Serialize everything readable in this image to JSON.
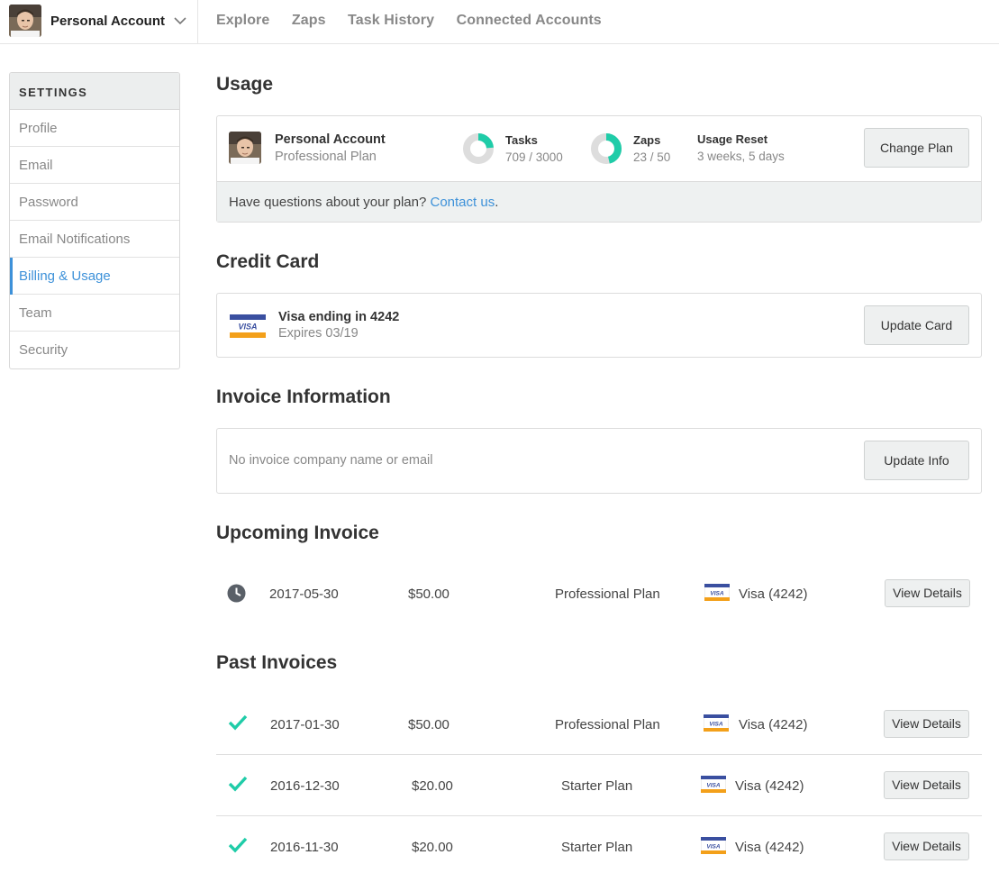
{
  "topbar": {
    "account_name": "Personal Account",
    "nav": [
      "Explore",
      "Zaps",
      "Task History",
      "Connected Accounts"
    ]
  },
  "sidebar": {
    "heading": "SETTINGS",
    "items": [
      {
        "label": "Profile",
        "active": false
      },
      {
        "label": "Email",
        "active": false
      },
      {
        "label": "Password",
        "active": false
      },
      {
        "label": "Email Notifications",
        "active": false
      },
      {
        "label": "Billing & Usage",
        "active": true
      },
      {
        "label": "Team",
        "active": false
      },
      {
        "label": "Security",
        "active": false
      }
    ]
  },
  "usage": {
    "title": "Usage",
    "account_name": "Personal Account",
    "plan": "Professional Plan",
    "tasks_label": "Tasks",
    "tasks_value": "709 / 3000",
    "tasks_fraction": 0.2363,
    "zaps_label": "Zaps",
    "zaps_value": "23 / 50",
    "zaps_fraction": 0.46,
    "reset_label": "Usage Reset",
    "reset_value": "3 weeks, 5 days",
    "change_plan": "Change Plan",
    "question": "Have questions about your plan?",
    "contact_link": "Contact us",
    "question_end": "."
  },
  "credit_card": {
    "title": "Credit Card",
    "card_line": "Visa ending in 4242",
    "expires": "Expires 03/19",
    "update_button": "Update Card",
    "brand_text": "VISA"
  },
  "invoice_info": {
    "title": "Invoice Information",
    "text": "No invoice company name or email",
    "update_button": "Update Info"
  },
  "upcoming": {
    "title": "Upcoming Invoice",
    "rows": [
      {
        "date": "2017-05-30",
        "amount": "$50.00",
        "plan": "Professional Plan",
        "card": "Visa (4242)",
        "button": "View Details"
      }
    ]
  },
  "past": {
    "title": "Past Invoices",
    "rows": [
      {
        "date": "2017-01-30",
        "amount": "$50.00",
        "plan": "Professional Plan",
        "card": "Visa (4242)",
        "button": "View Details"
      },
      {
        "date": "2016-12-30",
        "amount": "$20.00",
        "plan": "Starter Plan",
        "card": "Visa (4242)",
        "button": "View Details"
      },
      {
        "date": "2016-11-30",
        "amount": "$20.00",
        "plan": "Starter Plan",
        "card": "Visa (4242)",
        "button": "View Details"
      }
    ]
  },
  "colors": {
    "accent": "#3d91d9",
    "donut": "#1fcca8",
    "donut_track": "#dddddd",
    "check": "#1fcca8",
    "visa_blue": "#3a4fa0",
    "visa_gold": "#f3a01a"
  }
}
